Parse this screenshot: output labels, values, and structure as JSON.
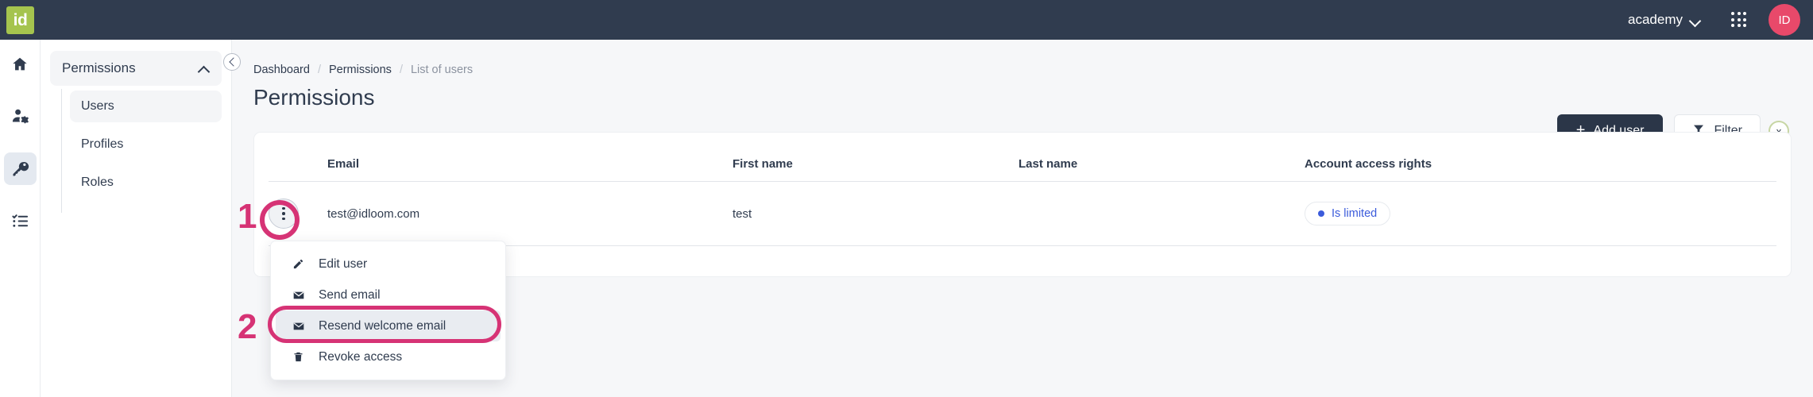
{
  "topbar": {
    "logo_text": "id",
    "account_name": "academy",
    "account_chevron_icon": "chevron-down-icon",
    "apps_icon": "app-grid-icon",
    "avatar_initials": "ID"
  },
  "rail": {
    "items": [
      {
        "name": "home",
        "icon": "home-icon",
        "active": false
      },
      {
        "name": "account-management",
        "icon": "user-gear-icon",
        "active": false
      },
      {
        "name": "permissions",
        "icon": "key-icon",
        "active": true
      },
      {
        "name": "tasks",
        "icon": "checklist-icon",
        "active": false
      }
    ]
  },
  "subnav": {
    "header_label": "Permissions",
    "header_chevron_icon": "chevron-up-icon",
    "items": [
      {
        "label": "Users",
        "active": true
      },
      {
        "label": "Profiles",
        "active": false
      },
      {
        "label": "Roles",
        "active": false
      }
    ],
    "collapse_icon": "chevron-left-icon"
  },
  "page": {
    "breadcrumb": [
      {
        "label": "Dashboard",
        "muted": false
      },
      {
        "label": "Permissions",
        "muted": false
      },
      {
        "label": "List of users",
        "muted": true
      }
    ],
    "breadcrumb_separator": "/",
    "title": "Permissions",
    "add_user_label": "Add user",
    "add_user_plus": "+",
    "filter_label": "Filter",
    "filter_icon": "funnel-icon",
    "filter_clear_label": "x",
    "filter_clear_icon": "close-icon"
  },
  "table": {
    "columns": [
      "Email",
      "First name",
      "Last name",
      "Account access rights"
    ],
    "rows": [
      {
        "actions_icon": "kebab-menu-icon",
        "email": "test@idloom.com",
        "first_name": "test",
        "last_name": "",
        "access_rights": "Is limited"
      }
    ]
  },
  "dropdown": {
    "items": [
      {
        "label": "Edit user",
        "icon": "pencil-icon",
        "highlight": false
      },
      {
        "label": "Send email",
        "icon": "envelope-icon",
        "highlight": false
      },
      {
        "label": "Resend welcome email",
        "icon": "envelope-icon",
        "highlight": true
      },
      {
        "label": "Revoke access",
        "icon": "trash-icon",
        "highlight": false
      }
    ]
  },
  "annotations": {
    "step_one": "1",
    "step_two": "2",
    "color": "#d63375"
  },
  "colors": {
    "topbar_bg": "#303c4f",
    "logo_bg": "#a5c44e",
    "avatar_bg": "#e8496a",
    "primary_btn_bg": "#2b3648",
    "badge_blue": "#3b5bdb",
    "annotation_pink": "#d63375",
    "filter_clear_border": "#c7d6a4",
    "content_bg": "#f6f7f9"
  }
}
